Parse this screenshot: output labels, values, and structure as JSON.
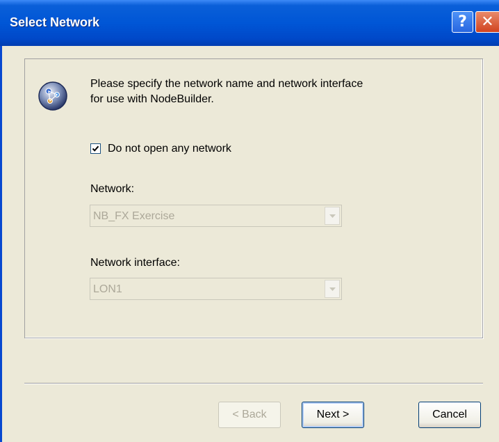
{
  "window": {
    "title": "Select Network",
    "help_glyph": "?",
    "close_glyph": "✕"
  },
  "intro": {
    "line1": "Please specify the network name and network interface",
    "line2": "for use with NodeBuilder."
  },
  "do_not_open": {
    "label": "Do not open any network",
    "checked": true
  },
  "network": {
    "label": "Network:",
    "value": "NB_FX Exercise"
  },
  "interface": {
    "label": "Network interface:",
    "value": "LON1"
  },
  "buttons": {
    "back": "< Back",
    "next": "Next >",
    "cancel": "Cancel"
  },
  "colors": {
    "titlebar": "#0056d6",
    "dialog_bg": "#ece9d8",
    "disabled_text": "#aca899"
  },
  "icons": {
    "app": "network-wizard-icon",
    "help": "help-icon",
    "close": "close-icon",
    "dropdown": "chevron-down-icon"
  }
}
